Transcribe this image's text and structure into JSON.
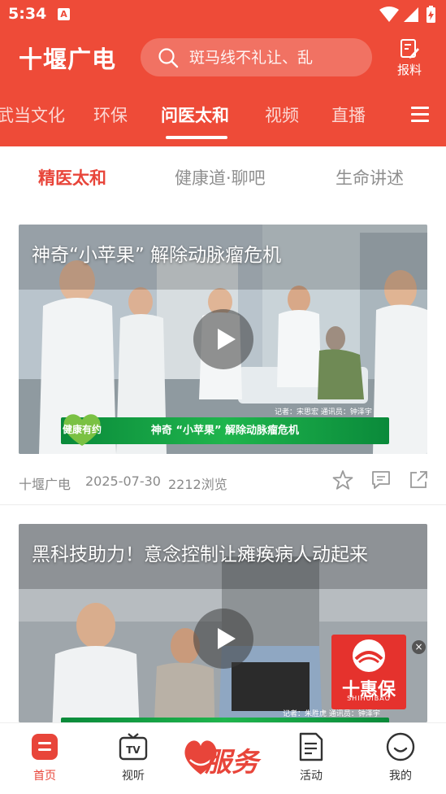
{
  "status_bar": {
    "time": "5:34",
    "notification_glyph": "A"
  },
  "header": {
    "app_title": "十堰广电",
    "search_placeholder": "斑马线不礼让、乱",
    "report_label": "报料"
  },
  "channel_tabs": [
    {
      "label": "武当文化",
      "active": false
    },
    {
      "label": "环保",
      "active": false
    },
    {
      "label": "问医太和",
      "active": true
    },
    {
      "label": "视频",
      "active": false
    },
    {
      "label": "直播",
      "active": false
    }
  ],
  "sub_tabs": [
    {
      "label": "精医太和",
      "active": true
    },
    {
      "label": "健康道·聊吧",
      "active": false
    },
    {
      "label": "生命讲述",
      "active": false
    }
  ],
  "articles": [
    {
      "title": "神奇“小苹果” 解除动脉瘤危机",
      "caption": "神奇 “小苹果” 解除动脉瘤危机",
      "reporter": "记者：宋思宏  通讯员：钟泽宇",
      "source": "十堰广电",
      "date": "2025-07-30",
      "views": "2212浏览"
    },
    {
      "title": "黑科技助力！意念控制让瘫痪病人动起来",
      "reporter": "记者：朱胜虎  通讯员：钟泽宇"
    }
  ],
  "video_badge": "健康有约",
  "ad": {
    "title": "十惠保",
    "subtitle": "SHIHUIBAO",
    "close_glyph": "×"
  },
  "bottom_nav": {
    "home": "首页",
    "watch": "视听",
    "service": "服务",
    "activity": "活动",
    "mine": "我的"
  },
  "colors": {
    "brand_red": "#ee4b38",
    "accent_red": "#e8453a",
    "caption_green": "#1fb54d"
  }
}
